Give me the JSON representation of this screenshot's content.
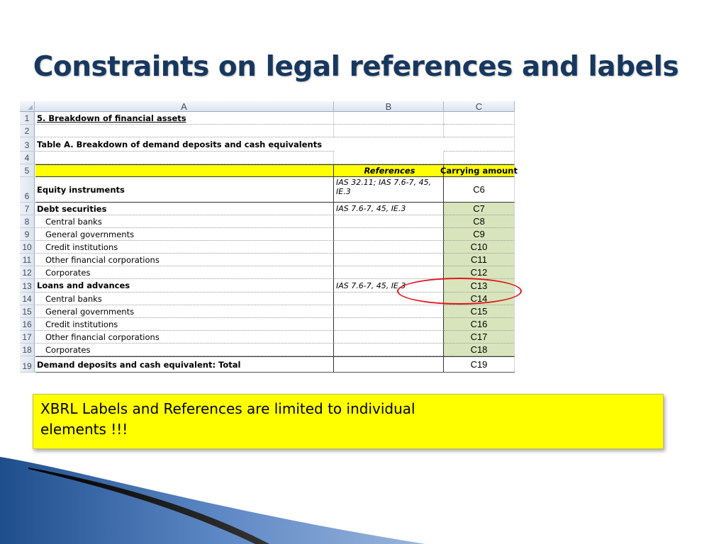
{
  "slide": {
    "title": "Constraints on legal references and labels",
    "note": "XBRL Labels and References are limited to individual elements !!!"
  },
  "spreadsheet": {
    "columns": [
      "A",
      "B",
      "C"
    ],
    "rows": [
      {
        "n": "1",
        "a": "5. Breakdown of financial assets",
        "b": "",
        "c": ""
      },
      {
        "n": "2",
        "a": "",
        "b": "",
        "c": ""
      },
      {
        "n": "3",
        "a": "Table A. Breakdown of demand deposits and cash equivalents",
        "b": "",
        "c": ""
      },
      {
        "n": "4",
        "a": "",
        "b": "",
        "c": ""
      },
      {
        "n": "5",
        "a": "",
        "b": "References",
        "c": "Carrying amount"
      },
      {
        "n": "6",
        "a": "Equity instruments",
        "b": "IAS 32.11; IAS 7.6-7, 45, IE.3",
        "c": "C6"
      },
      {
        "n": "7",
        "a": "Debt securities",
        "b": "IAS 7.6-7, 45, IE.3",
        "c": "C7"
      },
      {
        "n": "8",
        "a": "Central banks",
        "b": "",
        "c": "C8"
      },
      {
        "n": "9",
        "a": "General governments",
        "b": "",
        "c": "C9"
      },
      {
        "n": "10",
        "a": "Credit institutions",
        "b": "",
        "c": "C10"
      },
      {
        "n": "11",
        "a": "Other financial corporations",
        "b": "",
        "c": "C11"
      },
      {
        "n": "12",
        "a": "Corporates",
        "b": "",
        "c": "C12"
      },
      {
        "n": "13",
        "a": "Loans and advances",
        "b": "IAS 7.6-7, 45, IE.3",
        "c": "C13"
      },
      {
        "n": "14",
        "a": "Central banks",
        "b": "",
        "c": "C14"
      },
      {
        "n": "15",
        "a": "General governments",
        "b": "",
        "c": "C15"
      },
      {
        "n": "16",
        "a": "Credit institutions",
        "b": "",
        "c": "C16"
      },
      {
        "n": "17",
        "a": "Other financial corporations",
        "b": "",
        "c": "C17"
      },
      {
        "n": "18",
        "a": "Corporates",
        "b": "",
        "c": "C18"
      },
      {
        "n": "19",
        "a": "Demand deposits and cash equivalent: Total",
        "b": "",
        "c": "C19"
      }
    ]
  },
  "colors": {
    "title": "#17375e",
    "header_fill": "#ffff00",
    "value_fill": "#d8e4bc",
    "highlight_oval": "#e1141c"
  }
}
